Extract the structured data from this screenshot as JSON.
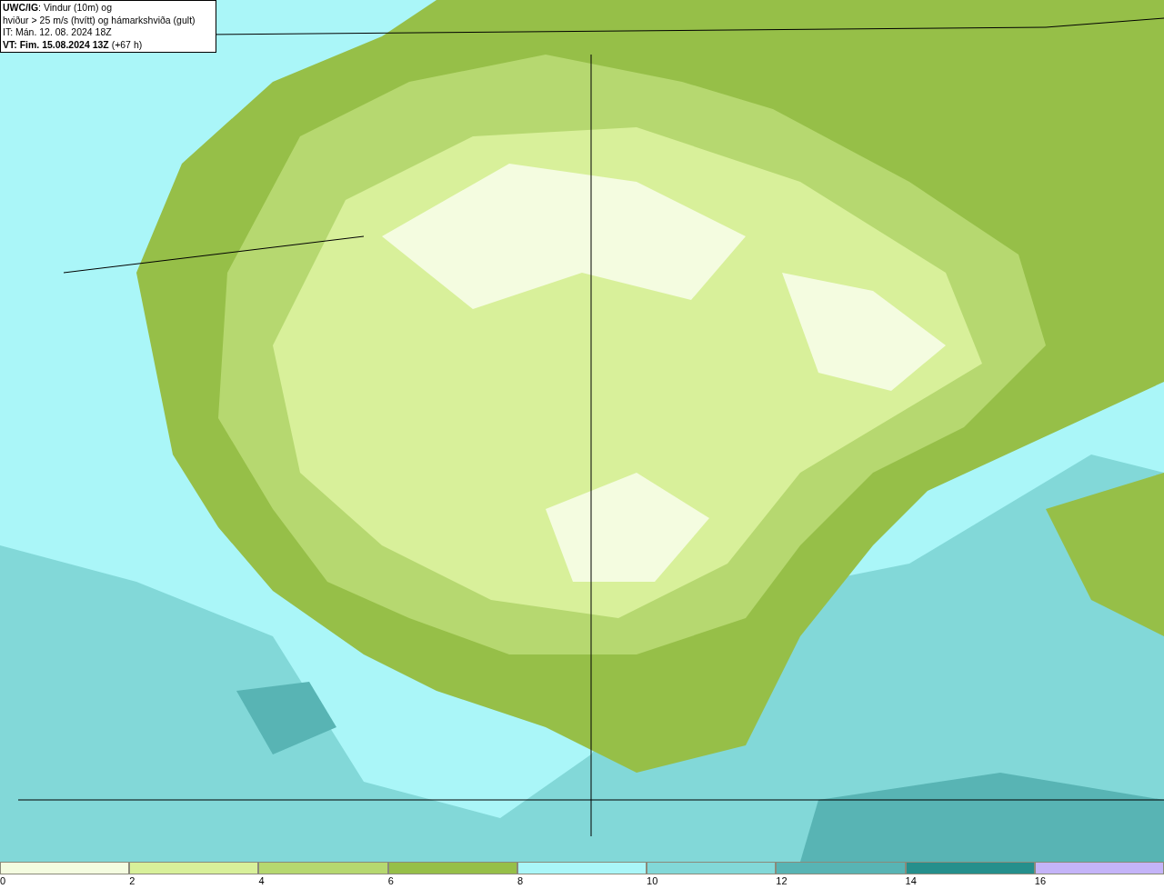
{
  "info_box": {
    "lines": [
      "**UWC/IG**: Vindur (10m) og",
      "hviður > 25 m/s (hvítt) og hámarkshviða (gult)",
      "IT: Mán. 12. 08. 2024 18Z",
      "**VT: Fim. 15.08.2024 13Z** (+67 h)"
    ]
  },
  "colorbar": {
    "bins": [
      {
        "color": "#f4fce0",
        "label": "0"
      },
      {
        "color": "#d8f09a",
        "label": "2"
      },
      {
        "color": "#b6d870",
        "label": "4"
      },
      {
        "color": "#96bf48",
        "label": "6"
      },
      {
        "color": "#aaf6f8",
        "label": "8"
      },
      {
        "color": "#82d8d8",
        "label": "10"
      },
      {
        "color": "#58b4b4",
        "label": "12"
      },
      {
        "color": "#258f8c",
        "label": "14"
      },
      {
        "color": "#c4b4f8",
        "label": "16"
      }
    ]
  }
}
